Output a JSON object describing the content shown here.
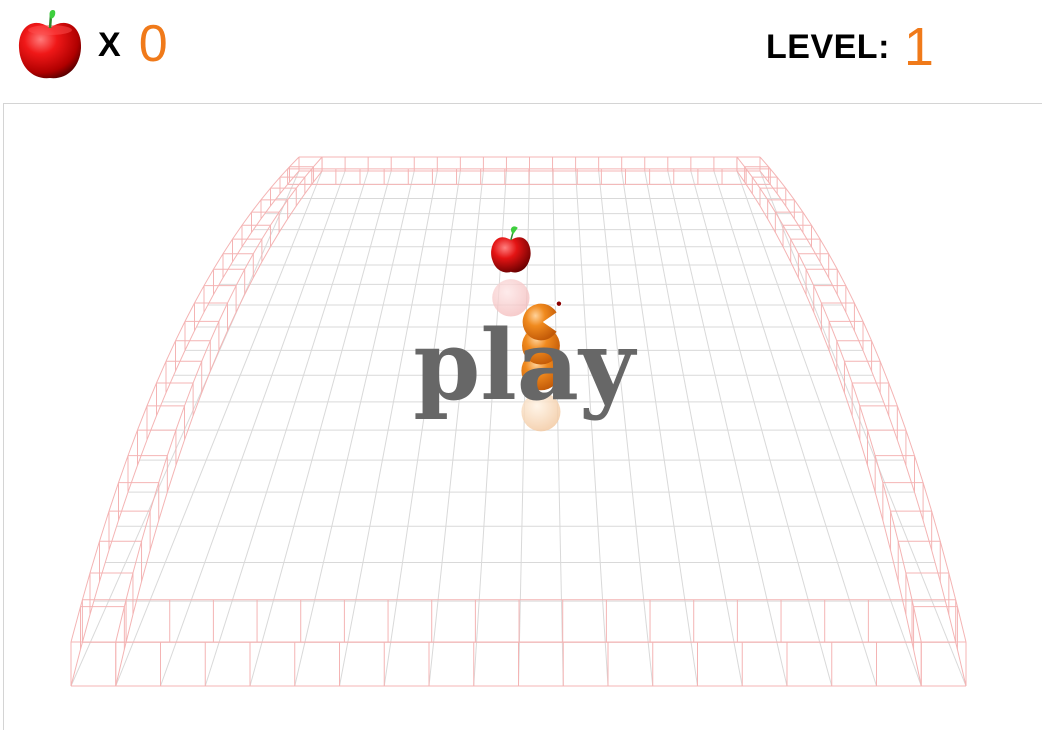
{
  "hud": {
    "apples_icon": "apple-icon",
    "times_label": "X",
    "apple_count": "0",
    "level_label": "LEVEL:",
    "level_value": "1"
  },
  "board": {
    "play_label": "play",
    "grid_columns": 20,
    "grid_rows": 20,
    "apple": {
      "col": 9,
      "row": 6
    },
    "snake": [
      {
        "col": 10,
        "row": 9,
        "part": "head",
        "facing": "right"
      },
      {
        "col": 10,
        "row": 10,
        "part": "body"
      },
      {
        "col": 10,
        "row": 11,
        "part": "body"
      }
    ]
  },
  "colors": {
    "accent": "#f07a1a",
    "grid_line": "#d9d9d9",
    "wall": "#f4b4b4",
    "apple": "#e01010",
    "play_text": "#676767"
  }
}
